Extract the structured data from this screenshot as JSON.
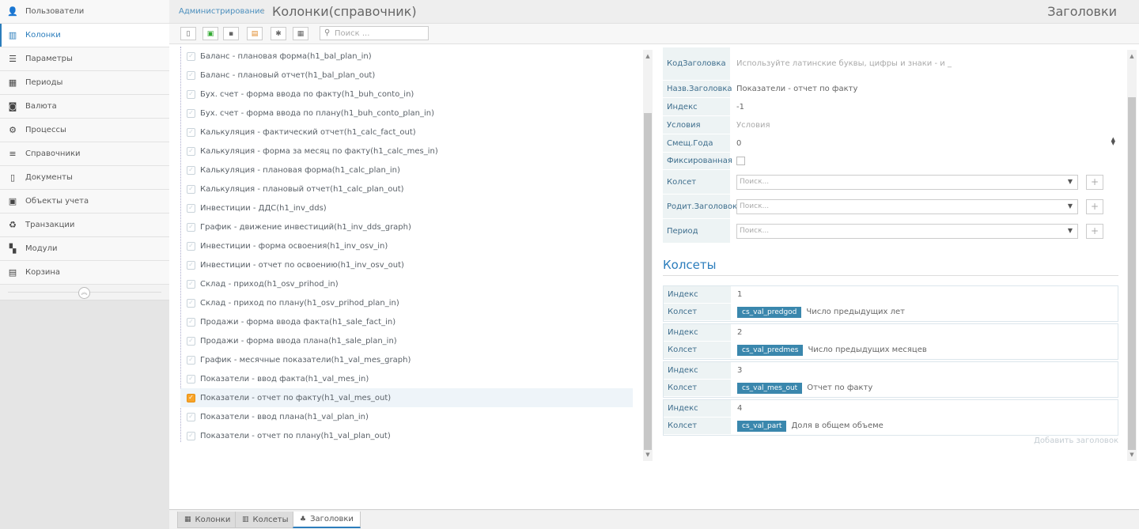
{
  "sidebar": {
    "items": [
      {
        "label": "Пользователи",
        "icon": "user-secret-icon",
        "glyph": "👤",
        "active": false
      },
      {
        "label": "Колонки",
        "icon": "columns-icon",
        "glyph": "▥",
        "active": true
      },
      {
        "label": "Параметры",
        "icon": "sliders-icon",
        "glyph": "☰",
        "active": false
      },
      {
        "label": "Периоды",
        "icon": "calendar-icon",
        "glyph": "▦",
        "active": false
      },
      {
        "label": "Валюта",
        "icon": "money-icon",
        "glyph": "◙",
        "active": false
      },
      {
        "label": "Процессы",
        "icon": "handshake-icon",
        "glyph": "⚙",
        "active": false
      },
      {
        "label": "Справочники",
        "icon": "list-icon",
        "glyph": "≡",
        "active": false
      },
      {
        "label": "Документы",
        "icon": "file-icon",
        "glyph": "▯",
        "active": false
      },
      {
        "label": "Объекты учета",
        "icon": "clipboard-icon",
        "glyph": "▣",
        "active": false
      },
      {
        "label": "Транзакции",
        "icon": "recycle-icon",
        "glyph": "♻",
        "active": false
      },
      {
        "label": "Модули",
        "icon": "th-large-icon",
        "glyph": "▚",
        "active": false
      },
      {
        "label": "Корзина",
        "icon": "trash-icon",
        "glyph": "▤",
        "active": false
      }
    ]
  },
  "header": {
    "breadcrumb": "Администрирование",
    "title": "Колонки(справочник)",
    "right_title": "Заголовки"
  },
  "toolbar": {
    "search_placeholder": "Поиск ..."
  },
  "tree": {
    "items": [
      {
        "label": "Баланс - плановая форма(h1_bal_plan_in)",
        "checked": false
      },
      {
        "label": "Баланс - плановый отчет(h1_bal_plan_out)",
        "checked": false
      },
      {
        "label": "Бух. счет - форма ввода по факту(h1_buh_conto_in)",
        "checked": false
      },
      {
        "label": "Бух. счет - форма ввода по плану(h1_buh_conto_plan_in)",
        "checked": false
      },
      {
        "label": "Калькуляция - фактический отчет(h1_calc_fact_out)",
        "checked": false
      },
      {
        "label": "Калькуляция - форма за месяц по факту(h1_calc_mes_in)",
        "checked": false
      },
      {
        "label": "Калькуляция - плановая форма(h1_calc_plan_in)",
        "checked": false
      },
      {
        "label": "Калькуляция - плановый отчет(h1_calc_plan_out)",
        "checked": false
      },
      {
        "label": "Инвестиции - ДДС(h1_inv_dds)",
        "checked": false
      },
      {
        "label": "График - движение инвестиций(h1_inv_dds_graph)",
        "checked": false
      },
      {
        "label": "Инвестиции - форма освоения(h1_inv_osv_in)",
        "checked": false
      },
      {
        "label": "Инвестиции - отчет по освоению(h1_inv_osv_out)",
        "checked": false
      },
      {
        "label": "Склад - приход(h1_osv_prihod_in)",
        "checked": false
      },
      {
        "label": "Склад - приход по плану(h1_osv_prihod_plan_in)",
        "checked": false
      },
      {
        "label": "Продажи - форма ввода факта(h1_sale_fact_in)",
        "checked": false
      },
      {
        "label": "Продажи - форма ввода плана(h1_sale_plan_in)",
        "checked": false
      },
      {
        "label": "График - месячные показатели(h1_val_mes_graph)",
        "checked": false
      },
      {
        "label": "Показатели - ввод факта(h1_val_mes_in)",
        "checked": false
      },
      {
        "label": "Показатели - отчет по факту(h1_val_mes_out)",
        "checked": true
      },
      {
        "label": "Показатели - ввод плана(h1_val_plan_in)",
        "checked": false
      },
      {
        "label": "Показатели - отчет по плану(h1_val_plan_out)",
        "checked": false
      }
    ]
  },
  "form": {
    "code_label": "КодЗаголовка",
    "code_placeholder": "Используйте латинские буквы, цифры и знаки - и _",
    "name_label": "Назв.Заголовка",
    "name_value": "Показатели - отчет по факту",
    "index_label": "Индекс",
    "index_value": "-1",
    "cond_label": "Условия",
    "cond_placeholder": "Условия",
    "shift_label": "Смещ.Года",
    "shift_value": "0",
    "fixed_label": "Фиксированная",
    "kolset_label": "Колсет",
    "parent_label": "Родит.Заголовок",
    "period_label": "Период",
    "select_placeholder": "Поиск...",
    "add_symbol": "+"
  },
  "kolsets": {
    "title": "Колсеты",
    "index_label": "Индекс",
    "kolset_label": "Колсет",
    "items": [
      {
        "index": "1",
        "tag": "cs_val_predgod",
        "desc": "Число предыдущих лет"
      },
      {
        "index": "2",
        "tag": "cs_val_predmes",
        "desc": "Число предыдущих месяцев"
      },
      {
        "index": "3",
        "tag": "cs_val_mes_out",
        "desc": "Отчет по факту"
      },
      {
        "index": "4",
        "tag": "cs_val_part",
        "desc": "Доля в общем объеме"
      }
    ],
    "add_link": "Добавить заголовок"
  },
  "bottom_tabs": [
    {
      "label": "Колонки",
      "icon": "table-icon",
      "glyph": "▦",
      "active": false
    },
    {
      "label": "Колсеты",
      "icon": "columns-icon",
      "glyph": "▥",
      "active": false
    },
    {
      "label": "Заголовки",
      "icon": "sitemap-icon",
      "glyph": "♣",
      "active": true
    }
  ],
  "colors": {
    "accent": "#2b7dbc",
    "tag": "#3a87ad",
    "checked": "#f8a42a"
  }
}
